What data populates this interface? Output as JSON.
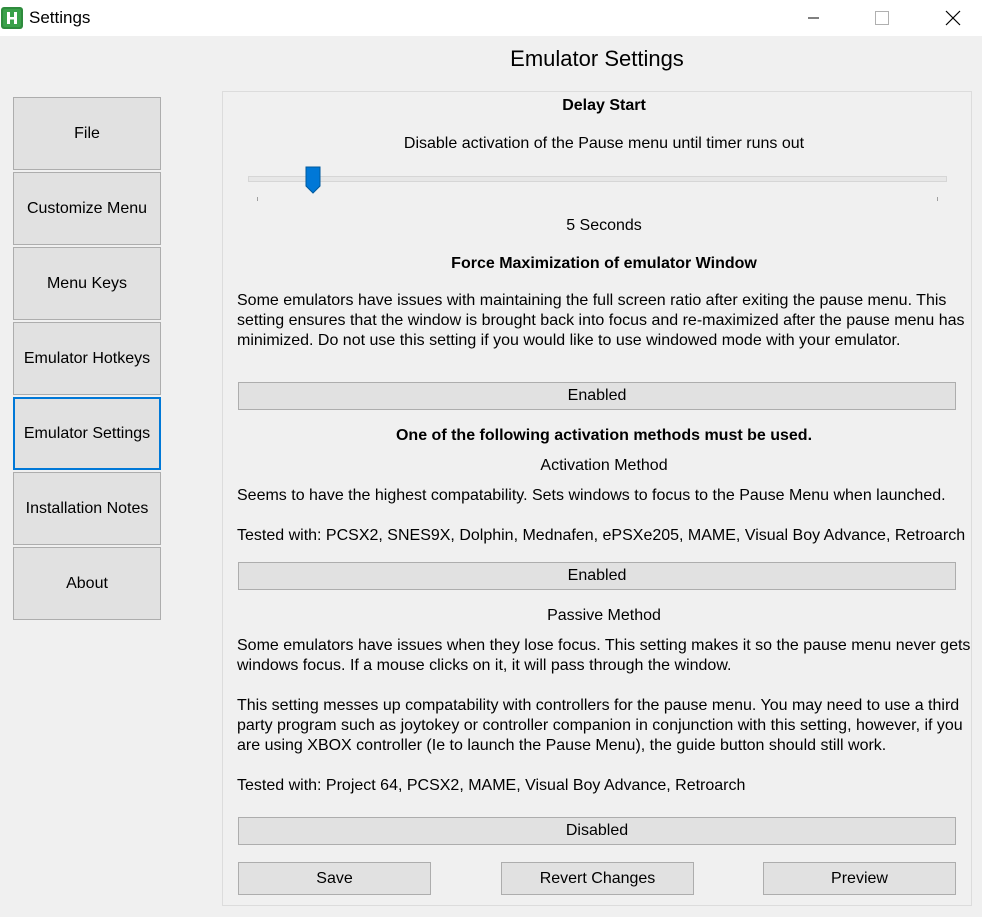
{
  "window": {
    "title": "Settings",
    "icon": "h-app-icon"
  },
  "page_title": "Emulator Settings",
  "sidebar": {
    "items": [
      {
        "label": "File"
      },
      {
        "label": "Customize Menu"
      },
      {
        "label": "Menu Keys"
      },
      {
        "label": "Emulator Hotkeys"
      },
      {
        "label": "Emulator Settings",
        "active": true
      },
      {
        "label": "Installation Notes"
      },
      {
        "label": "About"
      }
    ]
  },
  "delay_start": {
    "heading": "Delay Start",
    "description": "Disable activation of the Pause menu until timer runs out",
    "value_label": "5 Seconds",
    "slider_value": 5
  },
  "force_max": {
    "heading": "Force Maximization of emulator Window",
    "description": "Some emulators have issues with maintaining the full screen ratio after exiting the pause menu. This setting ensures that the window is brought back into focus and re-maximized after the pause menu has minimized. Do not use this setting if you would like to use windowed mode with your emulator.",
    "button_label": "Enabled"
  },
  "activation": {
    "notice": "One of the following activation methods must be used.",
    "heading": "Activation Method",
    "description": "Seems to have the highest compatability. Sets windows to focus to the Pause Menu when launched.",
    "tested": "Tested with: PCSX2, SNES9X, Dolphin, Mednafen, ePSXe205, MAME, Visual Boy Advance, Retroarch",
    "button_label": "Enabled"
  },
  "passive": {
    "heading": "Passive Method",
    "description": "Some emulators have issues when they lose focus. This setting makes it so the pause menu never gets windows focus. If a mouse clicks on it, it will pass through the window.",
    "warning": "This setting messes up compatability with controllers for the pause menu. You may need to use a third party program such as joytokey or controller companion in conjunction with this setting, however, if you are using XBOX controller (Ie to launch the Pause Menu), the guide button should still work.",
    "tested": "Tested with: Project 64, PCSX2, MAME, Visual Boy Advance, Retroarch",
    "button_label": "Disabled"
  },
  "actions": {
    "save": "Save",
    "revert": "Revert Changes",
    "preview": "Preview"
  },
  "colors": {
    "accent": "#0078d7",
    "app_icon": "#2e8b3d"
  }
}
